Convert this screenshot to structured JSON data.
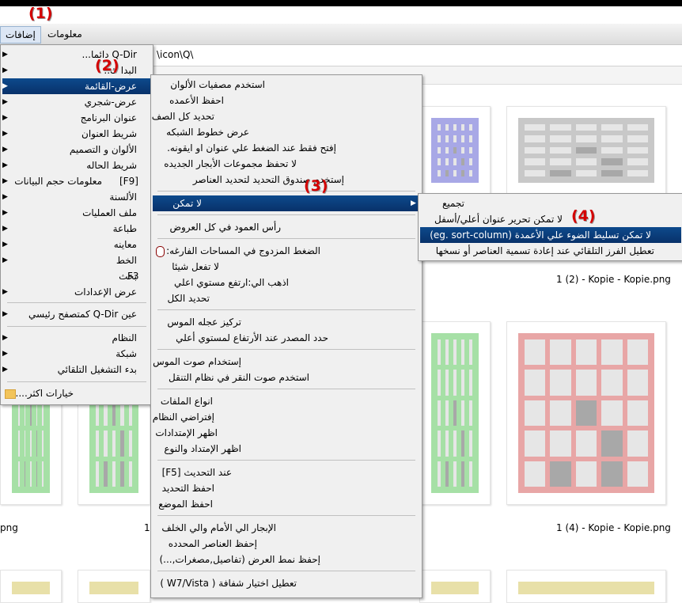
{
  "markers": {
    "m1": "(1)",
    "m2": "(2)",
    "m3": "(3)",
    "m4": "(4)"
  },
  "menubar": {
    "addons": "إضافات",
    "info": "معلومات"
  },
  "address": "\\icon\\Q\\",
  "captions": {
    "c1": "1 (2) - Kopie - Kopie.png",
    "c2": "1 (4) - Kopie - Kopie.png",
    "c3": "png",
    "c4": "1"
  },
  "main_menu": {
    "items": [
      {
        "label": "Q-Dir دائما...",
        "arrow": "▶"
      },
      {
        "label": "البدا ك..",
        "arrow": "▶"
      },
      {
        "label": "عرض-القائمة",
        "arrow": "▶"
      },
      {
        "label": "عرض-شجري",
        "arrow": "▶"
      },
      {
        "label": "عنوان البرنامج",
        "arrow": "▶"
      },
      {
        "label": "شريط العنوان",
        "arrow": "▶"
      },
      {
        "label": "الألوان و التصميم",
        "arrow": "▶"
      },
      {
        "label": "شريط الحاله",
        "arrow": "▶"
      },
      {
        "label": "معلومات حجم البيانات",
        "shortcut": "[F9]",
        "arrow": "▶"
      },
      {
        "label": "الألسنة",
        "arrow": "▶"
      },
      {
        "label": "ملف العمليات",
        "arrow": "▶"
      },
      {
        "label": "طباعة",
        "arrow": "▶"
      },
      {
        "label": "معاينه",
        "arrow": "▶"
      },
      {
        "label": "الخط",
        "arrow": "▶"
      },
      {
        "label": "بحث",
        "shortcut": "F3",
        "arrow": "▶"
      },
      {
        "label": "عرض الإعدادات",
        "arrow": "▶"
      },
      {
        "label": "عين Q-Dir كمتصفح رئيسي",
        "arrow": "▶"
      },
      {
        "label": "النظام",
        "arrow": "▶"
      },
      {
        "label": "شبكة",
        "arrow": "▶"
      },
      {
        "label": "بدء التشغيل التلقائي",
        "arrow": "▶"
      },
      {
        "label": "خيارات اكثر...."
      }
    ]
  },
  "sub_menu": {
    "items": [
      "استخدم مصفيات الألوان",
      "احفظ الأعمده",
      "تحديد كل الصف",
      "عرض خطوط الشبكه",
      "إفتح فقط عند الضغط علي عنوان او ايقونه.",
      "لا تحفظ مجموعات الأبجار الجديده",
      "إستخدم صندوق التحديد لتحديد العناصر",
      "لا تمكن",
      "رأس العمود في كل العروض",
      "الضغط المزدوج في المساحات الفارغه:",
      "لا تفعل شيئا",
      "اذهب الي:ارتفع مستوي اعلي",
      "تحديد الكل",
      "تركيز عجله الموس",
      "حدد المصدر عند الأرتفاع لمستوي أعلي",
      "إستخدام صوت الموس",
      "استخدم صوت النقر في نظام التنقل",
      "انواع الملفات",
      "إفتراضي النظام",
      "اظهر الإمتدادات",
      "اظهر الإمتداد والنوع",
      "عند التحديث [F5]",
      "احفظ التحديد",
      "احفظ الموضع",
      "الإبجار الي الأمام والي الخلف",
      "إحفظ العناصر المحدده",
      "إحفظ نمط العرض (تفاصيل,مصغرات,...)",
      "تعطيل اختيار شفافة ( W7/Vista )"
    ],
    "arrow": "▶"
  },
  "sub_sub_menu": {
    "items": [
      "تجميع",
      "لا تمكن تحرير عنوان أعلي/أسفل",
      "لا تمكن تسليط الضوء علي الأعمدة (eg. sort-column)",
      "تعطيل الفرز التلقائي عند إعادة تسمية العناصر أو نسخها"
    ]
  },
  "colors": {
    "blue": "#a8a8e6",
    "gray": "#c8c8c8",
    "green": "#a6e0a6",
    "red": "#e8a6a6",
    "yellow": "#e8e0a8"
  },
  "icons": [
    "folder-icon",
    "mouse-icon",
    "chevron-right-icon"
  ]
}
